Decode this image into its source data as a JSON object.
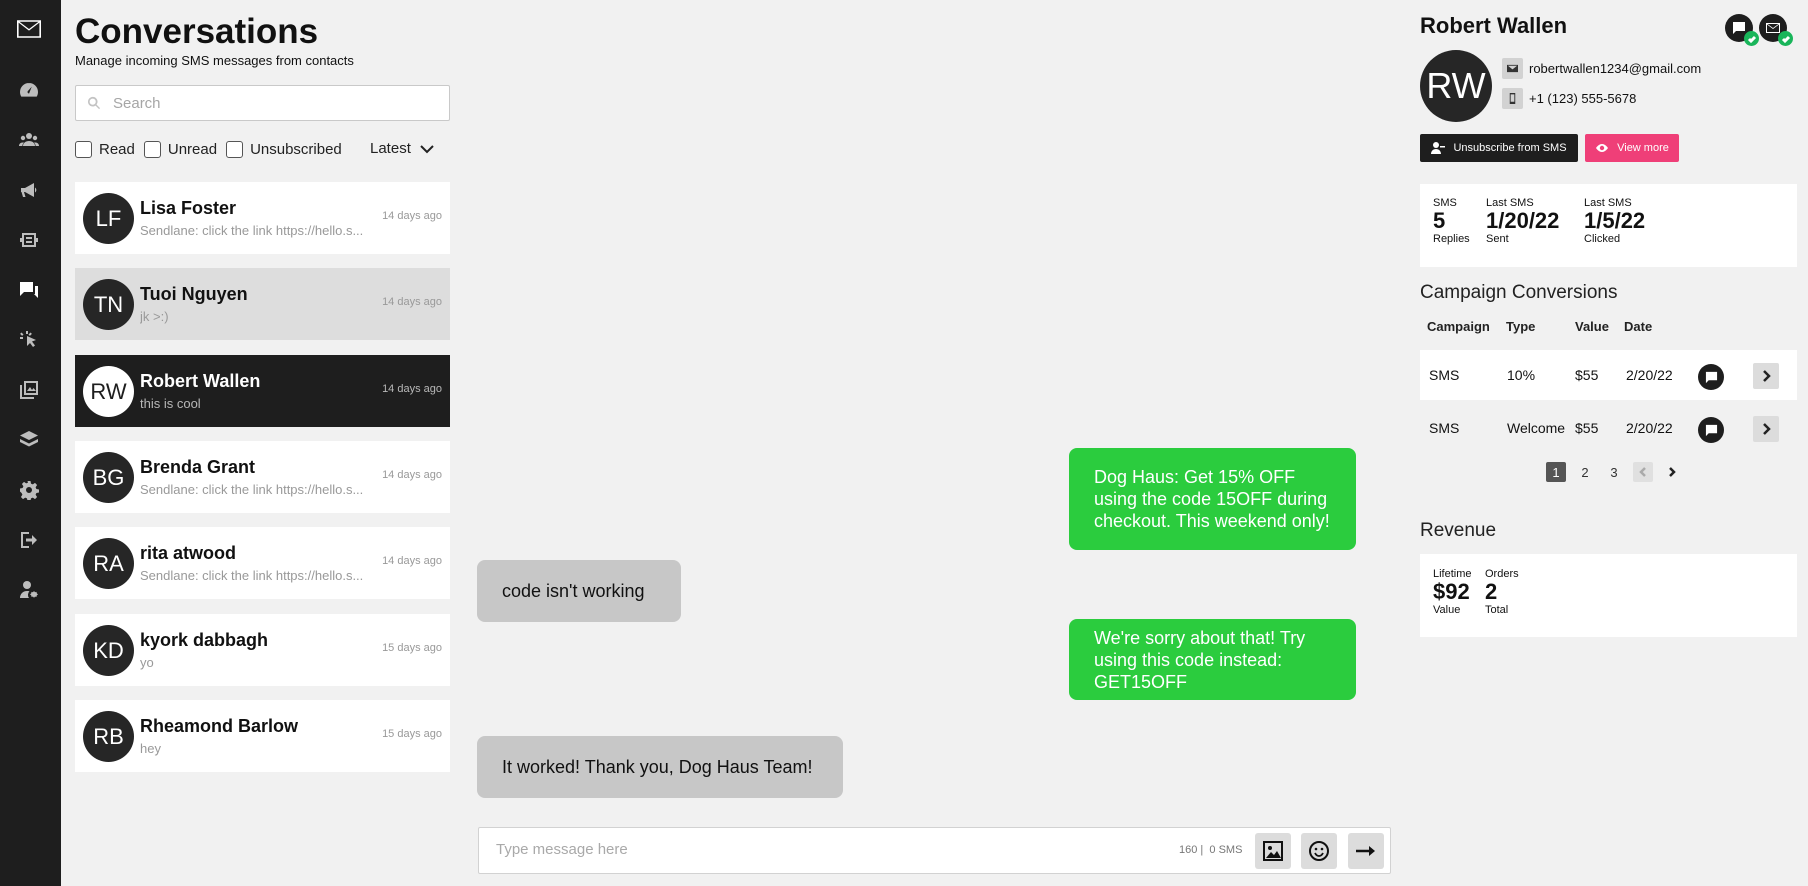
{
  "rail": {
    "icons": [
      "mail-logo-icon",
      "dashboard-icon",
      "audience-icon",
      "campaign-icon",
      "automation-icon",
      "conversations-icon",
      "click-tracking-icon",
      "media-library-icon",
      "integrations-icon",
      "settings-icon",
      "logout-icon",
      "account-settings-icon"
    ],
    "active": "conversations-icon"
  },
  "list": {
    "title": "Conversations",
    "subtitle": "Manage incoming SMS messages from contacts",
    "search_placeholder": "Search",
    "filters": [
      "Read",
      "Unread",
      "Unsubscribed"
    ],
    "sort_label": "Latest",
    "conversations": [
      {
        "initials": "LF",
        "name": "Lisa Foster",
        "snippet": "Sendlane: click the link https://hello.s...",
        "time": "14 days ago"
      },
      {
        "initials": "TN",
        "name": "Tuoi Nguyen",
        "snippet": "jk >:)",
        "time": "14 days ago"
      },
      {
        "initials": "RW",
        "name": "Robert Wallen",
        "snippet": "this is cool",
        "time": "14 days ago"
      },
      {
        "initials": "BG",
        "name": "Brenda Grant",
        "snippet": "Sendlane: click the link https://hello.s...",
        "time": "14 days ago"
      },
      {
        "initials": "RA",
        "name": "rita atwood",
        "snippet": "Sendlane: click the link https://hello.s...",
        "time": "14 days ago"
      },
      {
        "initials": "KD",
        "name": "kyork dabbagh",
        "snippet": "yo",
        "time": "15 days ago"
      },
      {
        "initials": "RB",
        "name": "Rheamond Barlow",
        "snippet": "hey",
        "time": "15 days ago"
      }
    ]
  },
  "chat": {
    "messages": [
      {
        "direction": "out",
        "text": "Dog Haus: Get 15% OFF using the code 15OFF during checkout. This weekend only!"
      },
      {
        "direction": "in",
        "text": "code isn't working"
      },
      {
        "direction": "out",
        "text": "We're sorry about that! Try using this code instead: GET15OFF"
      },
      {
        "direction": "in",
        "text": "It worked! Thank you, Dog Haus Team!"
      }
    ],
    "composer": {
      "placeholder": "Type message here",
      "char_count": "160",
      "sms_count": "0 SMS"
    }
  },
  "contact": {
    "name": "Robert Wallen",
    "initials": "RW",
    "email": "robertwallen1234@gmail.com",
    "phone": "+1 (123) 555-5678",
    "unsubscribe_label": "Unsubscribe from SMS",
    "view_more_label": "View more",
    "stats": [
      {
        "key": "SMS",
        "value": "5",
        "sub": "Replies"
      },
      {
        "key": "Last SMS",
        "value": "1/20/22",
        "sub": "Sent"
      },
      {
        "key": "Last SMS",
        "value": "1/5/22",
        "sub": "Clicked"
      }
    ],
    "conversions": {
      "title": "Campaign Conversions",
      "headers": [
        "Campaign",
        "Type",
        "Value",
        "Date"
      ],
      "rows": [
        {
          "campaign": "SMS",
          "type": "10%",
          "value": "$55",
          "date": "2/20/22"
        },
        {
          "campaign": "SMS",
          "type": "Welcome",
          "value": "$55",
          "date": "2/20/22"
        }
      ],
      "pages": [
        "1",
        "2",
        "3"
      ],
      "current_page": "1"
    },
    "revenue": {
      "title": "Revenue",
      "stats": [
        {
          "key": "Lifetime",
          "value": "$92",
          "sub": "Value"
        },
        {
          "key": "Orders",
          "value": "2",
          "sub": "Total"
        }
      ]
    }
  }
}
